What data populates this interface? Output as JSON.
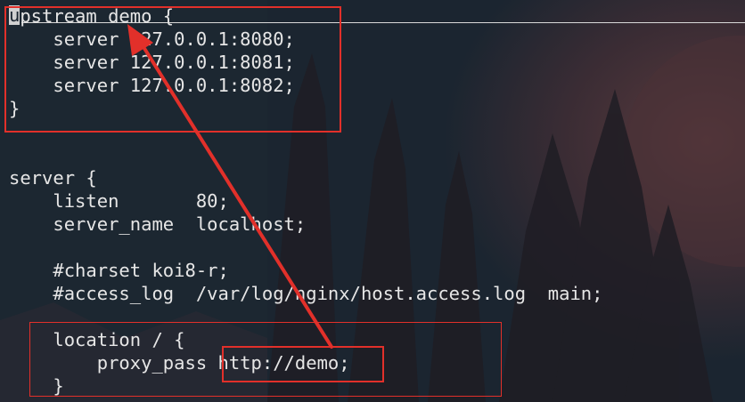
{
  "editor": {
    "cursor_char": "u",
    "lines": [
      "upstream demo {",
      "    server 127.0.0.1:8080;",
      "    server 127.0.0.1:8081;",
      "    server 127.0.0.1:8082;",
      "}",
      "",
      "",
      "server {",
      "    listen       80;",
      "    server_name  localhost;",
      "",
      "    #charset koi8-r;",
      "    #access_log  /var/log/nginx/host.access.log  main;",
      "",
      "    location / {",
      "        proxy_pass http://demo;",
      "    }"
    ]
  },
  "annotations": {
    "color": "#e2302a",
    "upstream_box": "upstream block highlight",
    "location_box": "location block highlight",
    "proxy_box": "proxy_pass target highlight",
    "arrow": "arrow from proxy_pass target to upstream"
  }
}
